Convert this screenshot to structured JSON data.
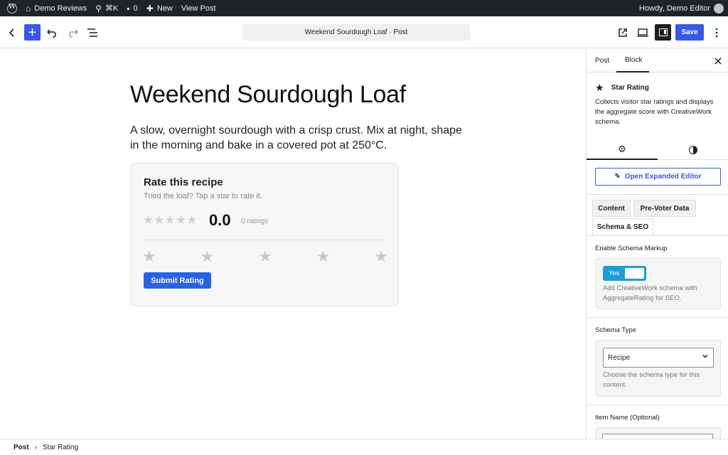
{
  "admin_bar": {
    "site_name": "Demo Reviews",
    "search_shortcut": "⌘K",
    "comments_count": "0",
    "new_label": "New",
    "view_post_label": "View Post",
    "greeting": "Howdy, Demo Editor"
  },
  "header": {
    "document_title": "Weekend Sourdough Loaf · Post",
    "save_label": "Save"
  },
  "post": {
    "title": "Weekend Sourdough Loaf",
    "description": "A slow, overnight sourdough with a crisp crust. Mix at night, shape in the morning and bake in a covered pot at 250°C."
  },
  "rating_block": {
    "title": "Rate this recipe",
    "subtitle": "Tried the loaf? Tap a star to rate it.",
    "small_stars": "★★★★★",
    "score": "0.0",
    "ratings_count": "0 ratings",
    "rating_stars": [
      "★",
      "★",
      "★",
      "★",
      "★"
    ],
    "submit_label": "Submit Rating"
  },
  "sidebar": {
    "tab_post": "Post",
    "tab_block": "Block",
    "block_name": "Star Rating",
    "block_description": "Collects visitor star ratings and displays the aggregate score with CreativeWork schema.",
    "expanded_editor_label": "Open Expanded Editor",
    "panel_tabs": {
      "content": "Content",
      "pre_voter": "Pre-Voter Data",
      "schema": "Schema & SEO"
    },
    "schema_markup": {
      "label": "Enable Schema Markup",
      "toggle_label": "Yes",
      "enabled": true,
      "help": "Add CreativeWork schema with AggregateRating for SEO."
    },
    "schema_type": {
      "label": "Schema Type",
      "selected": "Recipe",
      "help": "Choose the schema type for this content."
    },
    "item_name_label": "Item Name (Optional)"
  },
  "footer": {
    "crumb_post": "Post",
    "separator": "›",
    "crumb_block": "Star Rating"
  },
  "colors": {
    "accent": "#3858e9",
    "submit": "#2563eb",
    "toggle": "#1a9ed9",
    "admin_bar": "#1d2327"
  }
}
